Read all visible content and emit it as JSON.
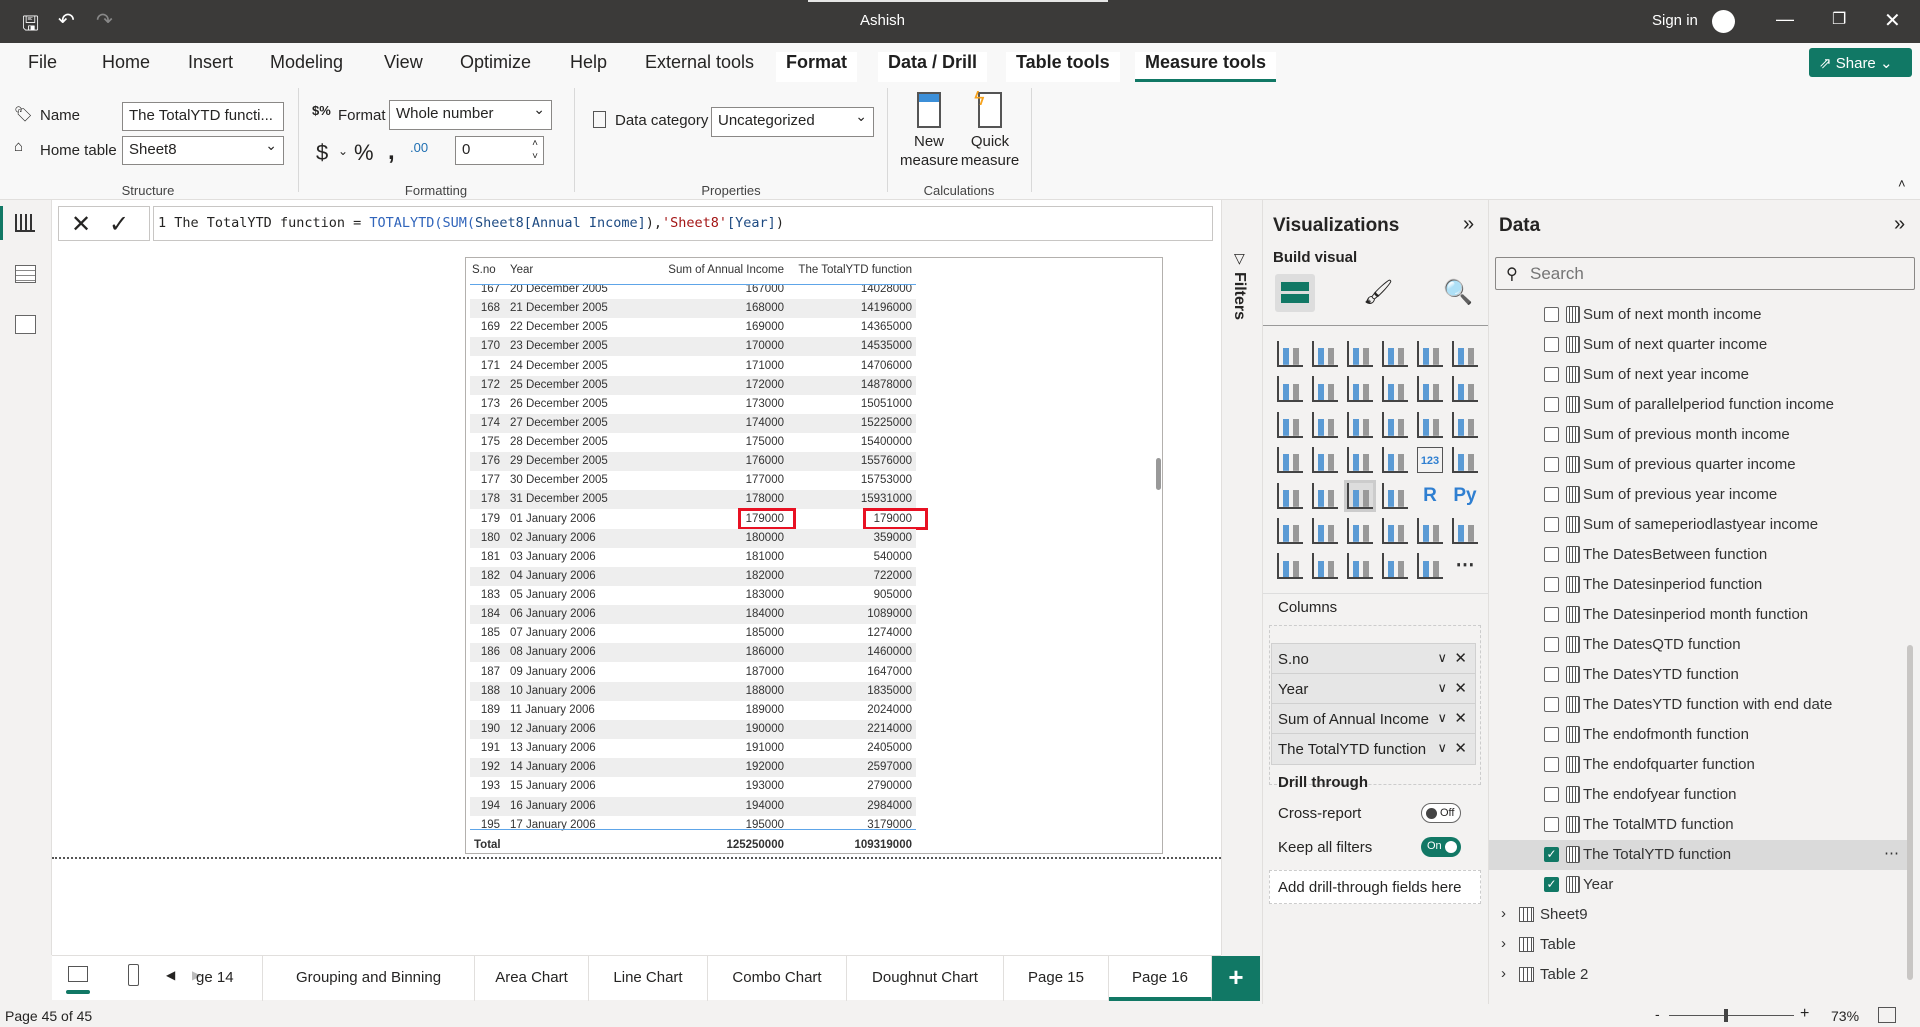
{
  "titlebar": {
    "title": "Ashish",
    "sign_in": "Sign in"
  },
  "menu": [
    "File",
    "Home",
    "Insert",
    "Modeling",
    "View",
    "Optimize",
    "Help",
    "External tools",
    "Format",
    "Data / Drill",
    "Table tools",
    "Measure tools"
  ],
  "share_label": "Share",
  "ribbon": {
    "name_label": "Name",
    "name_value": "The TotalYTD functi...",
    "home_table_label": "Home table",
    "home_table_value": "Sheet8",
    "structure": "Structure",
    "format_label": "Format",
    "format_value": "Whole number",
    "decimal_value": "0",
    "formatting": "Formatting",
    "data_category_label": "Data category",
    "data_category_value": "Uncategorized",
    "properties": "Properties",
    "new_measure": [
      "New",
      "measure"
    ],
    "quick_measure": [
      "Quick",
      "measure"
    ],
    "calculations": "Calculations"
  },
  "formula": {
    "line": "1",
    "name": "The TotalYTD function",
    "eq": " = ",
    "func": "TOTALYTD(",
    "sum": "SUM(",
    "arg1": "Sheet8[Annual Income]",
    "close1": ")",
    "comma": ",",
    "table": "'Sheet8'",
    "col": "[Year]",
    "close2": ")"
  },
  "table": {
    "headers": [
      "S.no",
      "Year",
      "Sum of Annual Income",
      "The TotalYTD function"
    ],
    "rows": [
      [
        "167",
        "20 December 2005",
        "167000",
        "14028000"
      ],
      [
        "168",
        "21 December 2005",
        "168000",
        "14196000"
      ],
      [
        "169",
        "22 December 2005",
        "169000",
        "14365000"
      ],
      [
        "170",
        "23 December 2005",
        "170000",
        "14535000"
      ],
      [
        "171",
        "24 December 2005",
        "171000",
        "14706000"
      ],
      [
        "172",
        "25 December 2005",
        "172000",
        "14878000"
      ],
      [
        "173",
        "26 December 2005",
        "173000",
        "15051000"
      ],
      [
        "174",
        "27 December 2005",
        "174000",
        "15225000"
      ],
      [
        "175",
        "28 December 2005",
        "175000",
        "15400000"
      ],
      [
        "176",
        "29 December 2005",
        "176000",
        "15576000"
      ],
      [
        "177",
        "30 December 2005",
        "177000",
        "15753000"
      ],
      [
        "178",
        "31 December 2005",
        "178000",
        "15931000"
      ],
      [
        "179",
        "01 January 2006",
        "179000",
        "179000"
      ],
      [
        "180",
        "02 January 2006",
        "180000",
        "359000"
      ],
      [
        "181",
        "03 January 2006",
        "181000",
        "540000"
      ],
      [
        "182",
        "04 January 2006",
        "182000",
        "722000"
      ],
      [
        "183",
        "05 January 2006",
        "183000",
        "905000"
      ],
      [
        "184",
        "06 January 2006",
        "184000",
        "1089000"
      ],
      [
        "185",
        "07 January 2006",
        "185000",
        "1274000"
      ],
      [
        "186",
        "08 January 2006",
        "186000",
        "1460000"
      ],
      [
        "187",
        "09 January 2006",
        "187000",
        "1647000"
      ],
      [
        "188",
        "10 January 2006",
        "188000",
        "1835000"
      ],
      [
        "189",
        "11 January 2006",
        "189000",
        "2024000"
      ],
      [
        "190",
        "12 January 2006",
        "190000",
        "2214000"
      ],
      [
        "191",
        "13 January 2006",
        "191000",
        "2405000"
      ],
      [
        "192",
        "14 January 2006",
        "192000",
        "2597000"
      ],
      [
        "193",
        "15 January 2006",
        "193000",
        "2790000"
      ],
      [
        "194",
        "16 January 2006",
        "194000",
        "2984000"
      ],
      [
        "195",
        "17 January 2006",
        "195000",
        "3179000"
      ]
    ],
    "highlighted_sno": "179",
    "total": {
      "label": "Total",
      "income": "125250000",
      "ytd": "109319000"
    }
  },
  "filters_label": "Filters",
  "viz": {
    "title": "Visualizations",
    "build_visual": "Build visual",
    "icons": [
      "stacked-bar",
      "stacked-column",
      "clustered-bar",
      "clustered-column",
      "100-stacked-bar",
      "100-stacked-column",
      "line",
      "area",
      "stacked-area",
      "line-clustered-column",
      "line-stacked-column",
      "ribbon",
      "waterfall",
      "funnel",
      "scatter",
      "pie",
      "donut",
      "treemap",
      "map",
      "filled-map",
      "azure-map",
      "gauge",
      "card",
      "multi-row-card",
      "kpi",
      "slicer",
      "table",
      "matrix",
      "r-visual",
      "python-visual",
      "key-influencers",
      "decomposition-tree",
      "qa",
      "smart-narrative",
      "metrics",
      "paginated-report",
      "card-new",
      "slicer-new",
      "arcgis-map",
      "power-apps",
      "power-automate",
      "more"
    ],
    "selected_icon": "table",
    "columns_label": "Columns",
    "wells": [
      "S.no",
      "Year",
      "Sum of Annual Income",
      "The TotalYTD function"
    ],
    "drill_through": "Drill through",
    "cross_report": "Cross-report",
    "cross_report_state": "Off",
    "keep_filters": "Keep all filters",
    "keep_filters_state": "On",
    "add_drill": "Add drill-through fields here"
  },
  "data": {
    "title": "Data",
    "search_placeholder": "Search",
    "fields": [
      {
        "label": "Sum of next month income",
        "checked": false
      },
      {
        "label": "Sum of next quarter income",
        "checked": false
      },
      {
        "label": "Sum of next year income",
        "checked": false
      },
      {
        "label": "Sum of parallelperiod function income",
        "checked": false
      },
      {
        "label": "Sum of previous month income",
        "checked": false
      },
      {
        "label": "Sum of previous quarter income",
        "checked": false
      },
      {
        "label": "Sum of previous year income",
        "checked": false
      },
      {
        "label": "Sum of sameperiodlastyear income",
        "checked": false
      },
      {
        "label": "The DatesBetween function",
        "checked": false
      },
      {
        "label": "The Datesinperiod function",
        "checked": false
      },
      {
        "label": "The Datesinperiod month function",
        "checked": false
      },
      {
        "label": "The DatesQTD function",
        "checked": false
      },
      {
        "label": "The DatesYTD function",
        "checked": false
      },
      {
        "label": "The DatesYTD function with end date",
        "checked": false
      },
      {
        "label": "The endofmonth function",
        "checked": false
      },
      {
        "label": "The endofquarter function",
        "checked": false
      },
      {
        "label": "The endofyear function",
        "checked": false
      },
      {
        "label": "The TotalMTD function",
        "checked": false
      },
      {
        "label": "The TotalYTD function",
        "checked": true,
        "selected": true
      },
      {
        "label": "Year",
        "checked": true,
        "type": "column"
      }
    ],
    "tables": [
      "Sheet9",
      "Table",
      "Table 2"
    ]
  },
  "pages": [
    "ge 14",
    "Grouping and Binning",
    "Area Chart",
    "Line Chart",
    "Combo Chart",
    "Doughnut Chart",
    "Page 15",
    "Page 16"
  ],
  "active_page": "Page 16",
  "status": {
    "page": "Page 45 of 45",
    "zoom": "73%",
    "zoom_percent": 73
  },
  "colors": {
    "accent": "#117865",
    "highlight_box": "#e81123",
    "titlebar": "#3b3a39"
  }
}
